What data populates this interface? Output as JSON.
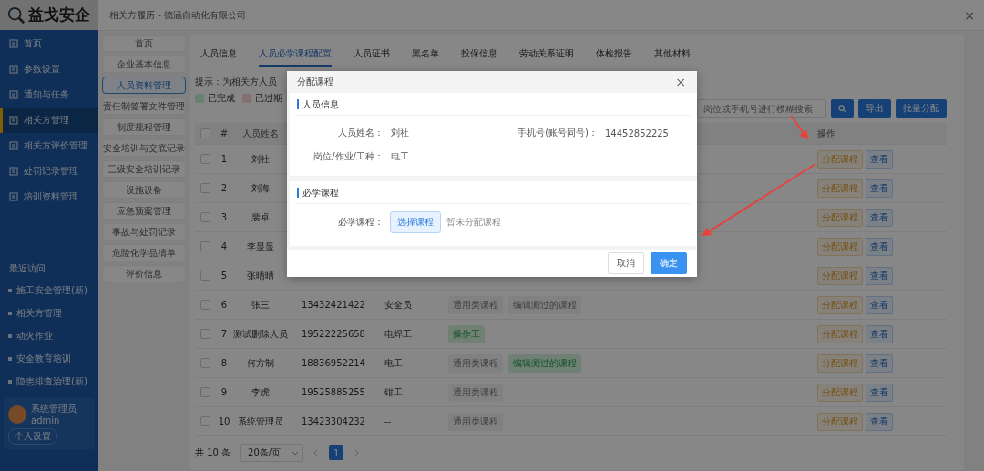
{
  "app": {
    "logo_text": "益戈安企"
  },
  "sidebar": {
    "items": [
      {
        "label": "首页",
        "selected": false
      },
      {
        "label": "参数设置",
        "selected": false
      },
      {
        "label": "通知与任务",
        "selected": false
      },
      {
        "label": "相关方管理",
        "selected": true
      },
      {
        "label": "相关方评价管理",
        "selected": false
      },
      {
        "label": "处罚记录管理",
        "selected": false
      },
      {
        "label": "培训资料管理",
        "selected": false
      }
    ],
    "recent_title": "最近访问",
    "recent": [
      "施工安全管理(新)",
      "相关方管理",
      "动火作业",
      "安全教育培训",
      "隐患排查治理(新)"
    ],
    "user": {
      "name": "系统管理员",
      "account": "admin",
      "settings": "个人设置"
    }
  },
  "drawer": {
    "title": "相关方履历 - 德涵自动化有限公司",
    "close": "×",
    "menu": [
      {
        "label": "首页",
        "selected": false
      },
      {
        "label": "企业基本信息",
        "selected": false
      },
      {
        "label": "人员资料管理",
        "selected": true
      },
      {
        "label": "责任制签署文件管理",
        "selected": false
      },
      {
        "label": "制度规程管理",
        "selected": false
      },
      {
        "label": "安全培训与交底记录",
        "selected": false
      },
      {
        "label": "三级安全培训记录",
        "selected": false
      },
      {
        "label": "设施设备",
        "selected": false
      },
      {
        "label": "应急预案管理",
        "selected": false
      },
      {
        "label": "事故与处罚记录",
        "selected": false
      },
      {
        "label": "危险化学品清单",
        "selected": false
      },
      {
        "label": "评价信息",
        "selected": false
      }
    ],
    "tabs": [
      {
        "label": "人员信息",
        "selected": false
      },
      {
        "label": "人员必学课程配置",
        "selected": true
      },
      {
        "label": "人员证书",
        "selected": false
      },
      {
        "label": "黑名单",
        "selected": false
      },
      {
        "label": "投保信息",
        "selected": false
      },
      {
        "label": "劳动关系证明",
        "selected": false
      },
      {
        "label": "体检报告",
        "selected": false
      },
      {
        "label": "其他材料",
        "selected": false
      }
    ],
    "tip": "提示：为相关方人员",
    "legend": [
      {
        "label": "已完成",
        "color": "#6a8070"
      },
      {
        "label": "已过期",
        "color": "#847070"
      }
    ],
    "search": {
      "placeholder": "岗位或手机号进行模糊搜索"
    },
    "buttons": [
      "导出",
      "批量分配"
    ],
    "table": {
      "columns": [
        "#",
        "人员姓名",
        "操作"
      ],
      "all_checked": false,
      "rows": [
        {
          "checked": false,
          "index": "1",
          "name": "刘社",
          "actions": [
            "分配课程",
            "查看"
          ]
        },
        {
          "checked": false,
          "index": "2",
          "name": "刘海",
          "actions": [
            "分配课程",
            "查看"
          ]
        },
        {
          "checked": false,
          "index": "3",
          "name": "裴卓",
          "actions": [
            "分配课程",
            "查看"
          ]
        },
        {
          "checked": false,
          "index": "4",
          "name": "李显显",
          "actions": [
            "分配课程",
            "查看"
          ]
        },
        {
          "checked": false,
          "index": "5",
          "name": "张晴晴",
          "actions": [
            "分配课程",
            "查看"
          ]
        },
        {
          "checked": false,
          "index": "6",
          "name": "张三",
          "phone": "13432421422",
          "job": "安全员",
          "courses": [
            {
              "label": "通用类课程",
              "kind": "normal"
            },
            {
              "label": "编辑测过的课程",
              "kind": "normal"
            }
          ],
          "actions": [
            "分配课程",
            "查看"
          ]
        },
        {
          "checked": false,
          "index": "7",
          "name": "测试删除人员",
          "phone": "19522225658",
          "job": "电焊工",
          "courses": [
            {
              "label": "操作工",
              "kind": "completed"
            }
          ],
          "actions": [
            "分配课程",
            "查看"
          ]
        },
        {
          "checked": false,
          "index": "8",
          "name": "何方制",
          "phone": "18836952214",
          "job": "电工",
          "courses": [
            {
              "label": "通用类课程",
              "kind": "normal"
            },
            {
              "label": "编辑测过的课程",
              "kind": "completed"
            }
          ],
          "actions": [
            "分配课程",
            "查看"
          ]
        },
        {
          "checked": false,
          "index": "9",
          "name": "李虎",
          "phone": "19525885255",
          "job": "钳工",
          "courses": [
            {
              "label": "通用类课程",
              "kind": "normal"
            }
          ],
          "actions": [
            "分配课程",
            "查看"
          ]
        },
        {
          "checked": false,
          "index": "10",
          "name": "系统管理员",
          "phone": "13423304232",
          "job": "--",
          "courses": [
            {
              "label": "通用类课程",
              "kind": "normal"
            }
          ],
          "actions": [
            "分配课程",
            "查看"
          ]
        }
      ]
    },
    "pagination": {
      "total": "共 10 条",
      "page_size": "20条/页",
      "pages": [
        {
          "label": "1",
          "selected": true
        }
      ]
    }
  },
  "dialog": {
    "title": "分配课程",
    "close": "×",
    "sections": [
      {
        "title": "人员信息",
        "fields": [
          {
            "label": "人员姓名：",
            "value": "刘社"
          },
          {
            "label": "手机号(账号同号)：",
            "value": "14452852225"
          },
          {
            "label": "岗位/作业/工种：",
            "value": "电工"
          }
        ]
      },
      {
        "title": "必学课程",
        "course_label": "必学课程：",
        "course_button": "选择课程",
        "course_empty": "暂未分配课程"
      }
    ],
    "buttons": [
      {
        "label": "取消",
        "kind": "default"
      },
      {
        "label": "确定",
        "kind": "primary"
      }
    ]
  }
}
